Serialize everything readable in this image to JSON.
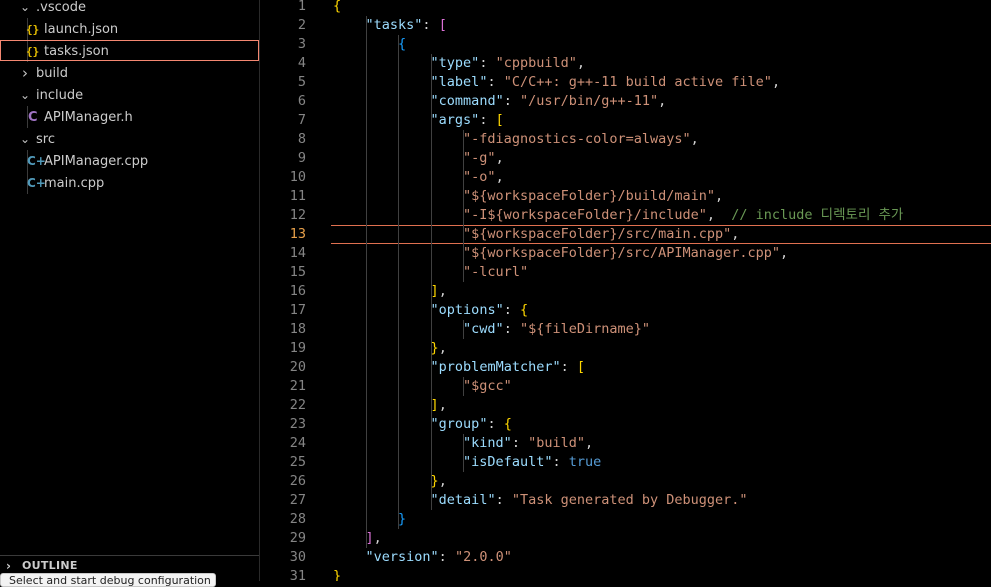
{
  "explorer": {
    "items": [
      {
        "name": ".vscode",
        "type": "folder",
        "expanded": true
      },
      {
        "name": "launch.json",
        "type": "json"
      },
      {
        "name": "tasks.json",
        "type": "json",
        "selected": true
      },
      {
        "name": "build",
        "type": "folder",
        "expanded": false
      },
      {
        "name": "include",
        "type": "folder",
        "expanded": true
      },
      {
        "name": "APIManager.h",
        "type": "c-header"
      },
      {
        "name": "src",
        "type": "folder",
        "expanded": true
      },
      {
        "name": "APIManager.cpp",
        "type": "cpp"
      },
      {
        "name": "main.cpp",
        "type": "cpp"
      }
    ],
    "json_icon": "{}",
    "c_icon": "C",
    "cpp_icon": "C+",
    "chevron_down": "⌄",
    "chevron_right": "›"
  },
  "outline": {
    "label": "OUTLINE"
  },
  "tooltip": {
    "text": "Select and start debug configuration"
  },
  "editor": {
    "active_line": 13,
    "line_numbers": [
      "1",
      "2",
      "3",
      "4",
      "5",
      "6",
      "7",
      "8",
      "9",
      "10",
      "11",
      "12",
      "13",
      "14",
      "15",
      "16",
      "17",
      "18",
      "19",
      "20",
      "21",
      "22",
      "23",
      "24",
      "25",
      "26",
      "27",
      "28",
      "29",
      "30",
      "31"
    ],
    "lines": [
      [
        {
          "t": "{",
          "c": "b1"
        }
      ],
      [
        {
          "t": "    "
        },
        {
          "t": "\"tasks\"",
          "c": "k"
        },
        {
          "t": ": "
        },
        {
          "t": "[",
          "c": "b2"
        }
      ],
      [
        {
          "t": "        "
        },
        {
          "t": "{",
          "c": "b3"
        }
      ],
      [
        {
          "t": "            "
        },
        {
          "t": "\"type\"",
          "c": "k"
        },
        {
          "t": ": "
        },
        {
          "t": "\"cppbuild\"",
          "c": "s"
        },
        {
          "t": ","
        }
      ],
      [
        {
          "t": "            "
        },
        {
          "t": "\"label\"",
          "c": "k"
        },
        {
          "t": ": "
        },
        {
          "t": "\"C/C++: g++-11 build active file\"",
          "c": "s"
        },
        {
          "t": ","
        }
      ],
      [
        {
          "t": "            "
        },
        {
          "t": "\"command\"",
          "c": "k"
        },
        {
          "t": ": "
        },
        {
          "t": "\"/usr/bin/g++-11\"",
          "c": "s"
        },
        {
          "t": ","
        }
      ],
      [
        {
          "t": "            "
        },
        {
          "t": "\"args\"",
          "c": "k"
        },
        {
          "t": ": "
        },
        {
          "t": "[",
          "c": "b1"
        }
      ],
      [
        {
          "t": "                "
        },
        {
          "t": "\"-fdiagnostics-color=always\"",
          "c": "s"
        },
        {
          "t": ","
        }
      ],
      [
        {
          "t": "                "
        },
        {
          "t": "\"-g\"",
          "c": "s"
        },
        {
          "t": ","
        }
      ],
      [
        {
          "t": "                "
        },
        {
          "t": "\"-o\"",
          "c": "s"
        },
        {
          "t": ","
        }
      ],
      [
        {
          "t": "                "
        },
        {
          "t": "\"${workspaceFolder}/build/main\"",
          "c": "s"
        },
        {
          "t": ","
        }
      ],
      [
        {
          "t": "                "
        },
        {
          "t": "\"-I${workspaceFolder}/include\"",
          "c": "s"
        },
        {
          "t": ",  "
        },
        {
          "t": "// include 디렉토리 추가",
          "c": "c"
        }
      ],
      [
        {
          "t": "                "
        },
        {
          "t": "\"${workspaceFolder}/src/main.cpp\"",
          "c": "s"
        },
        {
          "t": ","
        }
      ],
      [
        {
          "t": "                "
        },
        {
          "t": "\"${workspaceFolder}/src/APIManager.cpp\"",
          "c": "s"
        },
        {
          "t": ","
        }
      ],
      [
        {
          "t": "                "
        },
        {
          "t": "\"-lcurl\"",
          "c": "s"
        }
      ],
      [
        {
          "t": "            "
        },
        {
          "t": "]",
          "c": "b1"
        },
        {
          "t": ","
        }
      ],
      [
        {
          "t": "            "
        },
        {
          "t": "\"options\"",
          "c": "k"
        },
        {
          "t": ": "
        },
        {
          "t": "{",
          "c": "b1"
        }
      ],
      [
        {
          "t": "                "
        },
        {
          "t": "\"cwd\"",
          "c": "k"
        },
        {
          "t": ": "
        },
        {
          "t": "\"${fileDirname}\"",
          "c": "s"
        }
      ],
      [
        {
          "t": "            "
        },
        {
          "t": "}",
          "c": "b1"
        },
        {
          "t": ","
        }
      ],
      [
        {
          "t": "            "
        },
        {
          "t": "\"problemMatcher\"",
          "c": "k"
        },
        {
          "t": ": "
        },
        {
          "t": "[",
          "c": "b1"
        }
      ],
      [
        {
          "t": "                "
        },
        {
          "t": "\"$gcc\"",
          "c": "s"
        }
      ],
      [
        {
          "t": "            "
        },
        {
          "t": "]",
          "c": "b1"
        },
        {
          "t": ","
        }
      ],
      [
        {
          "t": "            "
        },
        {
          "t": "\"group\"",
          "c": "k"
        },
        {
          "t": ": "
        },
        {
          "t": "{",
          "c": "b1"
        }
      ],
      [
        {
          "t": "                "
        },
        {
          "t": "\"kind\"",
          "c": "k"
        },
        {
          "t": ": "
        },
        {
          "t": "\"build\"",
          "c": "s"
        },
        {
          "t": ","
        }
      ],
      [
        {
          "t": "                "
        },
        {
          "t": "\"isDefault\"",
          "c": "k"
        },
        {
          "t": ": "
        },
        {
          "t": "true",
          "c": "bool"
        }
      ],
      [
        {
          "t": "            "
        },
        {
          "t": "}",
          "c": "b1"
        },
        {
          "t": ","
        }
      ],
      [
        {
          "t": "            "
        },
        {
          "t": "\"detail\"",
          "c": "k"
        },
        {
          "t": ": "
        },
        {
          "t": "\"Task generated by Debugger.\"",
          "c": "s"
        }
      ],
      [
        {
          "t": "        "
        },
        {
          "t": "}",
          "c": "b3"
        }
      ],
      [
        {
          "t": "    "
        },
        {
          "t": "]",
          "c": "b2"
        },
        {
          "t": ","
        }
      ],
      [
        {
          "t": "    "
        },
        {
          "t": "\"version\"",
          "c": "k"
        },
        {
          "t": ": "
        },
        {
          "t": "\"2.0.0\"",
          "c": "s"
        }
      ],
      [
        {
          "t": "}",
          "c": "b1"
        }
      ]
    ]
  }
}
